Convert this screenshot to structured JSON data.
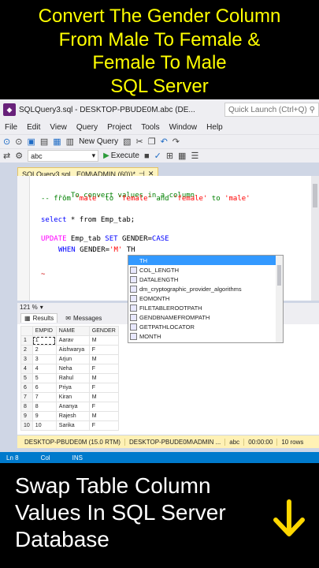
{
  "caption_top": {
    "lines": [
      "Convert The Gender Column",
      "From Male To Female &",
      "Female To Male",
      "SQL Server"
    ],
    "color": "#ffff00"
  },
  "window": {
    "title": "SQLQuery3.sql - DESKTOP-PBUDE0M.abc (DE...",
    "quick_launch_placeholder": "Quick Launch (Ctrl+Q)"
  },
  "menu": [
    "File",
    "Edit",
    "View",
    "Query",
    "Project",
    "Tools",
    "Window",
    "Help"
  ],
  "toolbar": {
    "new_query": "New Query",
    "database": "abc",
    "execute": "Execute"
  },
  "tab": {
    "label": "SQLQuery3.sql...E0M\\ADMIN (60))*"
  },
  "editor": {
    "comment1": "-- To convert values in a column",
    "comment2_prefix": "-- from ",
    "comment2_q1": "'male'",
    "comment2_mid1": " to ",
    "comment2_q2": "'female'",
    "comment2_mid2": " and ",
    "comment2_q3": "'female'",
    "comment2_mid3": " to ",
    "comment2_q4": "'male'",
    "select_kw": "select",
    "select_rest": " * from Emp_tab;",
    "update_kw": "UPDATE",
    "update_table": " Emp_tab ",
    "set_kw": "SET",
    "set_rest": " GENDER=",
    "case_kw": "CASE",
    "when_kw": "WHEN",
    "when_rest": " GENDER=",
    "when_val": "'M'",
    "typed": " TH",
    "squiggle": "~"
  },
  "autocomplete": {
    "items": [
      "TH",
      "COL_LENGTH",
      "DATALENGTH",
      "dm_cryptographic_provider_algorithms",
      "EOMONTH",
      "FILETABLEROOTPATH",
      "GENDBNAMEFROMPATH",
      "GETPATHLOCATOR",
      "MONTH"
    ]
  },
  "zoom": "121 %",
  "results": {
    "tab_results": "Results",
    "tab_messages": "Messages",
    "columns": [
      "EMPID",
      "NAME",
      "GENDER"
    ],
    "rows": [
      [
        "1",
        "1",
        "Aarav",
        "M"
      ],
      [
        "2",
        "2",
        "Aishwarya",
        "F"
      ],
      [
        "3",
        "3",
        "Arjun",
        "M"
      ],
      [
        "4",
        "4",
        "Neha",
        "F"
      ],
      [
        "5",
        "5",
        "Rahul",
        "M"
      ],
      [
        "6",
        "6",
        "Priya",
        "F"
      ],
      [
        "7",
        "7",
        "Kiran",
        "M"
      ],
      [
        "8",
        "8",
        "Ananya",
        "F"
      ],
      [
        "9",
        "9",
        "Rajesh",
        "M"
      ],
      [
        "10",
        "10",
        "Sarika",
        "F"
      ]
    ]
  },
  "query_status": {
    "server": "DESKTOP-PBUDE0M (15.0 RTM)",
    "user": "DESKTOP-PBUDE0M\\ADMIN ...",
    "database": "abc",
    "elapsed": "00:00:00",
    "rows": "10 rows"
  },
  "status_bar": {
    "line": "Ln 8",
    "col": "Col",
    "mode": "INS"
  },
  "caption_bottom": {
    "lines": [
      "Swap Table Column",
      "Values In SQL Server",
      "Database"
    ],
    "arrow_color": "#ffd700"
  }
}
